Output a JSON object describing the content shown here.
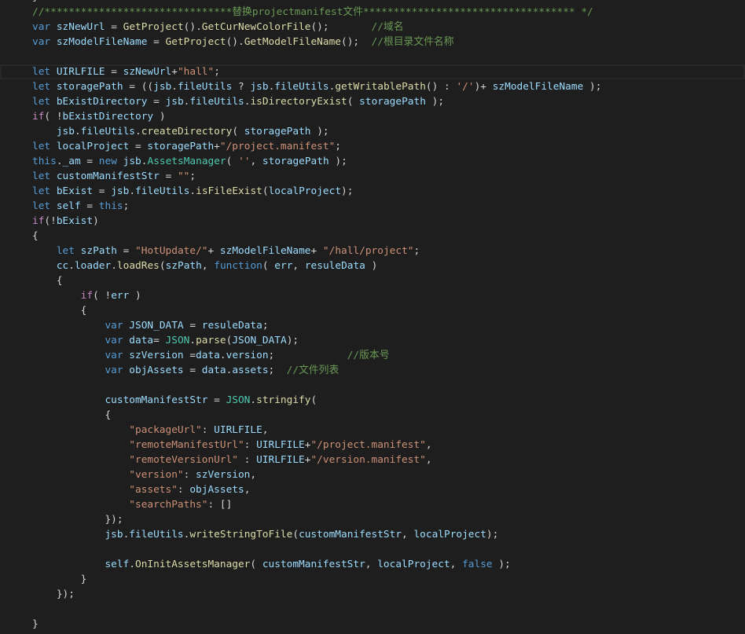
{
  "editor": {
    "theme": {
      "background": "#1e1e1e",
      "plain": "#d4d4d4",
      "keyword": "#569cd6",
      "control": "#c586c0",
      "variable": "#9cdcfe",
      "function": "#dcdcaa",
      "type": "#4ec9b0",
      "string": "#ce9178",
      "comment": "#6a9955",
      "current_line_border": "#282828"
    },
    "lines": [
      {
        "tokens": [
          [
            "}",
            "plain"
          ]
        ]
      },
      {
        "tokens": [
          [
            "//*******************************替换projectmanifest文件*********************************** */",
            "comment"
          ]
        ]
      },
      {
        "tokens": [
          [
            "var",
            "keyword"
          ],
          [
            " ",
            "plain"
          ],
          [
            "szNewUrl",
            "variable"
          ],
          [
            " = ",
            "plain"
          ],
          [
            "GetProject",
            "function"
          ],
          [
            "().",
            "plain"
          ],
          [
            "GetCurNewColorFile",
            "function"
          ],
          [
            "();       ",
            "plain"
          ],
          [
            "//域名",
            "comment"
          ]
        ]
      },
      {
        "tokens": [
          [
            "var",
            "keyword"
          ],
          [
            " ",
            "plain"
          ],
          [
            "szModelFileName",
            "variable"
          ],
          [
            " = ",
            "plain"
          ],
          [
            "GetProject",
            "function"
          ],
          [
            "().",
            "plain"
          ],
          [
            "GetModelFileName",
            "function"
          ],
          [
            "();  ",
            "plain"
          ],
          [
            "//根目录文件名称",
            "comment"
          ]
        ]
      },
      {
        "tokens": []
      },
      {
        "current": true,
        "tokens": [
          [
            "let",
            "keyword"
          ],
          [
            " ",
            "plain"
          ],
          [
            "UIRLFILE",
            "variable"
          ],
          [
            " = ",
            "plain"
          ],
          [
            "szNewUrl",
            "variable"
          ],
          [
            "+",
            "plain"
          ],
          [
            "\"hall\"",
            "string"
          ],
          [
            ";",
            "plain"
          ]
        ]
      },
      {
        "tokens": [
          [
            "let",
            "keyword"
          ],
          [
            " ",
            "plain"
          ],
          [
            "storagePath",
            "variable"
          ],
          [
            " = ((",
            "plain"
          ],
          [
            "jsb",
            "variable"
          ],
          [
            ".",
            "plain"
          ],
          [
            "fileUtils",
            "variable"
          ],
          [
            " ? ",
            "plain"
          ],
          [
            "jsb",
            "variable"
          ],
          [
            ".",
            "plain"
          ],
          [
            "fileUtils",
            "variable"
          ],
          [
            ".",
            "plain"
          ],
          [
            "getWritablePath",
            "function"
          ],
          [
            "() : ",
            "plain"
          ],
          [
            "'/'",
            "string"
          ],
          [
            ")+ ",
            "plain"
          ],
          [
            "szModelFileName",
            "variable"
          ],
          [
            " );",
            "plain"
          ]
        ]
      },
      {
        "tokens": [
          [
            "let",
            "keyword"
          ],
          [
            " ",
            "plain"
          ],
          [
            "bExistDirectory",
            "variable"
          ],
          [
            " = ",
            "plain"
          ],
          [
            "jsb",
            "variable"
          ],
          [
            ".",
            "plain"
          ],
          [
            "fileUtils",
            "variable"
          ],
          [
            ".",
            "plain"
          ],
          [
            "isDirectoryExist",
            "function"
          ],
          [
            "( ",
            "plain"
          ],
          [
            "storagePath",
            "variable"
          ],
          [
            " );",
            "plain"
          ]
        ]
      },
      {
        "tokens": [
          [
            "if",
            "control"
          ],
          [
            "( !",
            "plain"
          ],
          [
            "bExistDirectory",
            "variable"
          ],
          [
            " )",
            "plain"
          ]
        ]
      },
      {
        "tokens": [
          [
            "    ",
            "plain"
          ],
          [
            "jsb",
            "variable"
          ],
          [
            ".",
            "plain"
          ],
          [
            "fileUtils",
            "variable"
          ],
          [
            ".",
            "plain"
          ],
          [
            "createDirectory",
            "function"
          ],
          [
            "( ",
            "plain"
          ],
          [
            "storagePath",
            "variable"
          ],
          [
            " );",
            "plain"
          ]
        ]
      },
      {
        "tokens": [
          [
            "let",
            "keyword"
          ],
          [
            " ",
            "plain"
          ],
          [
            "localProject",
            "variable"
          ],
          [
            " = ",
            "plain"
          ],
          [
            "storagePath",
            "variable"
          ],
          [
            "+",
            "plain"
          ],
          [
            "\"/project.manifest\"",
            "string"
          ],
          [
            ";",
            "plain"
          ]
        ]
      },
      {
        "tokens": [
          [
            "this",
            "keyword"
          ],
          [
            ".",
            "plain"
          ],
          [
            "_am",
            "variable"
          ],
          [
            " = ",
            "plain"
          ],
          [
            "new",
            "keyword"
          ],
          [
            " ",
            "plain"
          ],
          [
            "jsb",
            "variable"
          ],
          [
            ".",
            "plain"
          ],
          [
            "AssetsManager",
            "type"
          ],
          [
            "( ",
            "plain"
          ],
          [
            "''",
            "string"
          ],
          [
            ", ",
            "plain"
          ],
          [
            "storagePath",
            "variable"
          ],
          [
            " );",
            "plain"
          ]
        ]
      },
      {
        "tokens": [
          [
            "let",
            "keyword"
          ],
          [
            " ",
            "plain"
          ],
          [
            "customManifestStr",
            "variable"
          ],
          [
            " = ",
            "plain"
          ],
          [
            "\"\"",
            "string"
          ],
          [
            ";",
            "plain"
          ]
        ]
      },
      {
        "tokens": [
          [
            "let",
            "keyword"
          ],
          [
            " ",
            "plain"
          ],
          [
            "bExist",
            "variable"
          ],
          [
            " = ",
            "plain"
          ],
          [
            "jsb",
            "variable"
          ],
          [
            ".",
            "plain"
          ],
          [
            "fileUtils",
            "variable"
          ],
          [
            ".",
            "plain"
          ],
          [
            "isFileExist",
            "function"
          ],
          [
            "(",
            "plain"
          ],
          [
            "localProject",
            "variable"
          ],
          [
            ");",
            "plain"
          ]
        ]
      },
      {
        "tokens": [
          [
            "let",
            "keyword"
          ],
          [
            " ",
            "plain"
          ],
          [
            "self",
            "variable"
          ],
          [
            " = ",
            "plain"
          ],
          [
            "this",
            "keyword"
          ],
          [
            ";",
            "plain"
          ]
        ]
      },
      {
        "tokens": [
          [
            "if",
            "control"
          ],
          [
            "(!",
            "plain"
          ],
          [
            "bExist",
            "variable"
          ],
          [
            ")",
            "plain"
          ]
        ]
      },
      {
        "tokens": [
          [
            "{",
            "plain"
          ]
        ]
      },
      {
        "tokens": [
          [
            "    ",
            "plain"
          ],
          [
            "let",
            "keyword"
          ],
          [
            " ",
            "plain"
          ],
          [
            "szPath",
            "variable"
          ],
          [
            " = ",
            "plain"
          ],
          [
            "\"HotUpdate/\"",
            "string"
          ],
          [
            "+ ",
            "plain"
          ],
          [
            "szModelFileName",
            "variable"
          ],
          [
            "+ ",
            "plain"
          ],
          [
            "\"/hall/project\"",
            "string"
          ],
          [
            ";",
            "plain"
          ]
        ]
      },
      {
        "tokens": [
          [
            "    ",
            "plain"
          ],
          [
            "cc",
            "variable"
          ],
          [
            ".",
            "plain"
          ],
          [
            "loader",
            "variable"
          ],
          [
            ".",
            "plain"
          ],
          [
            "loadRes",
            "function"
          ],
          [
            "(",
            "plain"
          ],
          [
            "szPath",
            "variable"
          ],
          [
            ", ",
            "plain"
          ],
          [
            "function",
            "keyword"
          ],
          [
            "( ",
            "plain"
          ],
          [
            "err",
            "variable"
          ],
          [
            ", ",
            "plain"
          ],
          [
            "resuleData",
            "variable"
          ],
          [
            " )",
            "plain"
          ]
        ]
      },
      {
        "tokens": [
          [
            "    {",
            "plain"
          ]
        ]
      },
      {
        "tokens": [
          [
            "        ",
            "plain"
          ],
          [
            "if",
            "control"
          ],
          [
            "( !",
            "plain"
          ],
          [
            "err",
            "variable"
          ],
          [
            " )",
            "plain"
          ]
        ]
      },
      {
        "tokens": [
          [
            "        {",
            "plain"
          ]
        ]
      },
      {
        "tokens": [
          [
            "            ",
            "plain"
          ],
          [
            "var",
            "keyword"
          ],
          [
            " ",
            "plain"
          ],
          [
            "JSON_DATA",
            "variable"
          ],
          [
            " = ",
            "plain"
          ],
          [
            "resuleData",
            "variable"
          ],
          [
            ";",
            "plain"
          ]
        ]
      },
      {
        "tokens": [
          [
            "            ",
            "plain"
          ],
          [
            "var",
            "keyword"
          ],
          [
            " ",
            "plain"
          ],
          [
            "data",
            "variable"
          ],
          [
            "= ",
            "plain"
          ],
          [
            "JSON",
            "type"
          ],
          [
            ".",
            "plain"
          ],
          [
            "parse",
            "function"
          ],
          [
            "(",
            "plain"
          ],
          [
            "JSON_DATA",
            "variable"
          ],
          [
            ");",
            "plain"
          ]
        ]
      },
      {
        "tokens": [
          [
            "            ",
            "plain"
          ],
          [
            "var",
            "keyword"
          ],
          [
            " ",
            "plain"
          ],
          [
            "szVersion",
            "variable"
          ],
          [
            " =",
            "plain"
          ],
          [
            "data",
            "variable"
          ],
          [
            ".",
            "plain"
          ],
          [
            "version",
            "variable"
          ],
          [
            ";            ",
            "plain"
          ],
          [
            "//版本号",
            "comment"
          ]
        ]
      },
      {
        "tokens": [
          [
            "            ",
            "plain"
          ],
          [
            "var",
            "keyword"
          ],
          [
            " ",
            "plain"
          ],
          [
            "objAssets",
            "variable"
          ],
          [
            " = ",
            "plain"
          ],
          [
            "data",
            "variable"
          ],
          [
            ".",
            "plain"
          ],
          [
            "assets",
            "variable"
          ],
          [
            ";  ",
            "plain"
          ],
          [
            "//文件列表",
            "comment"
          ]
        ]
      },
      {
        "tokens": []
      },
      {
        "tokens": [
          [
            "            ",
            "plain"
          ],
          [
            "customManifestStr",
            "variable"
          ],
          [
            " = ",
            "plain"
          ],
          [
            "JSON",
            "type"
          ],
          [
            ".",
            "plain"
          ],
          [
            "stringify",
            "function"
          ],
          [
            "(",
            "plain"
          ]
        ]
      },
      {
        "tokens": [
          [
            "            {",
            "plain"
          ]
        ]
      },
      {
        "tokens": [
          [
            "                ",
            "plain"
          ],
          [
            "\"packageUrl\"",
            "string"
          ],
          [
            ": ",
            "plain"
          ],
          [
            "UIRLFILE",
            "variable"
          ],
          [
            ",",
            "plain"
          ]
        ]
      },
      {
        "tokens": [
          [
            "                ",
            "plain"
          ],
          [
            "\"remoteManifestUrl\"",
            "string"
          ],
          [
            ": ",
            "plain"
          ],
          [
            "UIRLFILE",
            "variable"
          ],
          [
            "+",
            "plain"
          ],
          [
            "\"/project.manifest\"",
            "string"
          ],
          [
            ",",
            "plain"
          ]
        ]
      },
      {
        "tokens": [
          [
            "                ",
            "plain"
          ],
          [
            "\"remoteVersionUrl\"",
            "string"
          ],
          [
            " : ",
            "plain"
          ],
          [
            "UIRLFILE",
            "variable"
          ],
          [
            "+",
            "plain"
          ],
          [
            "\"/version.manifest\"",
            "string"
          ],
          [
            ",",
            "plain"
          ]
        ]
      },
      {
        "tokens": [
          [
            "                ",
            "plain"
          ],
          [
            "\"version\"",
            "string"
          ],
          [
            ": ",
            "plain"
          ],
          [
            "szVersion",
            "variable"
          ],
          [
            ",",
            "plain"
          ]
        ]
      },
      {
        "tokens": [
          [
            "                ",
            "plain"
          ],
          [
            "\"assets\"",
            "string"
          ],
          [
            ": ",
            "plain"
          ],
          [
            "objAssets",
            "variable"
          ],
          [
            ",",
            "plain"
          ]
        ]
      },
      {
        "tokens": [
          [
            "                ",
            "plain"
          ],
          [
            "\"searchPaths\"",
            "string"
          ],
          [
            ": []",
            "plain"
          ]
        ]
      },
      {
        "tokens": [
          [
            "            });",
            "plain"
          ]
        ]
      },
      {
        "tokens": [
          [
            "            ",
            "plain"
          ],
          [
            "jsb",
            "variable"
          ],
          [
            ".",
            "plain"
          ],
          [
            "fileUtils",
            "variable"
          ],
          [
            ".",
            "plain"
          ],
          [
            "writeStringToFile",
            "function"
          ],
          [
            "(",
            "plain"
          ],
          [
            "customManifestStr",
            "variable"
          ],
          [
            ", ",
            "plain"
          ],
          [
            "localProject",
            "variable"
          ],
          [
            ");",
            "plain"
          ]
        ]
      },
      {
        "tokens": []
      },
      {
        "tokens": [
          [
            "            ",
            "plain"
          ],
          [
            "self",
            "variable"
          ],
          [
            ".",
            "plain"
          ],
          [
            "OnInitAssetsManager",
            "function"
          ],
          [
            "( ",
            "plain"
          ],
          [
            "customManifestStr",
            "variable"
          ],
          [
            ", ",
            "plain"
          ],
          [
            "localProject",
            "variable"
          ],
          [
            ", ",
            "plain"
          ],
          [
            "false",
            "keyword"
          ],
          [
            " );",
            "plain"
          ]
        ]
      },
      {
        "tokens": [
          [
            "        }",
            "plain"
          ]
        ]
      },
      {
        "tokens": [
          [
            "    });",
            "plain"
          ]
        ]
      },
      {
        "tokens": []
      },
      {
        "tokens": [
          [
            "}",
            "plain"
          ]
        ]
      }
    ]
  }
}
